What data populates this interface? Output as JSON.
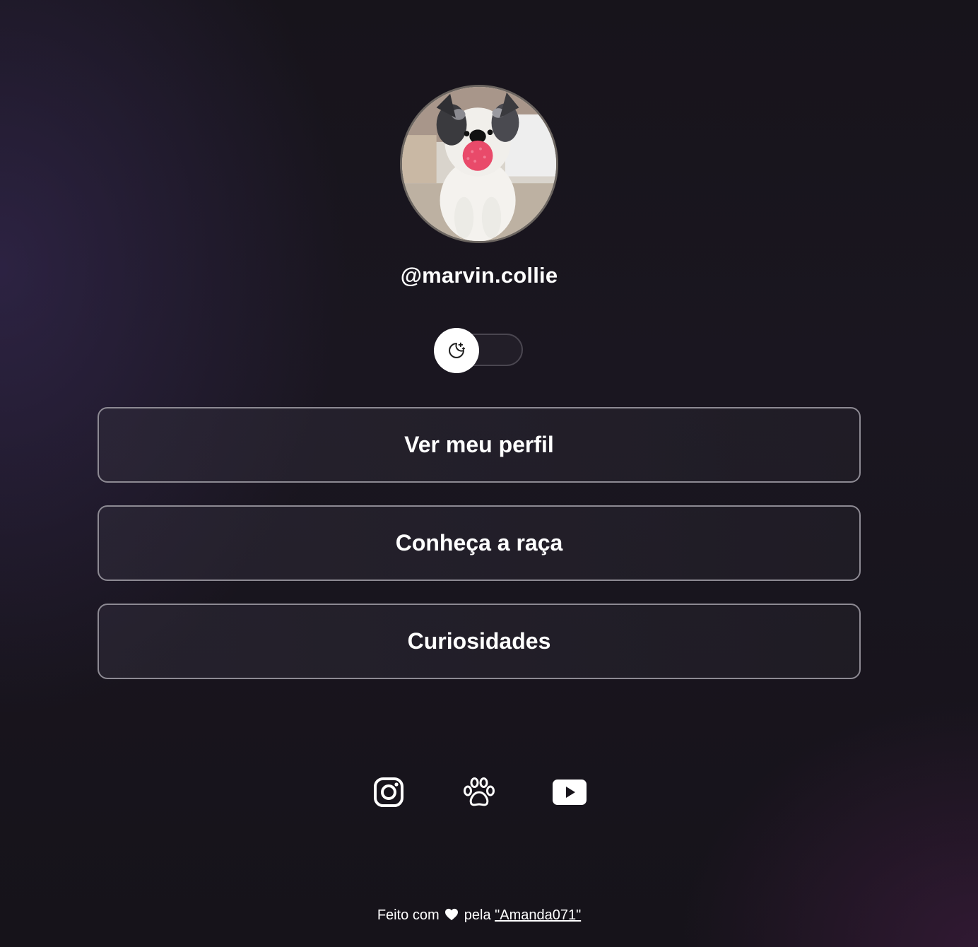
{
  "profile": {
    "avatar_alt": "dog-photo",
    "username": "@marvin.collie"
  },
  "theme_toggle": {
    "icon": "moon-stars-icon",
    "state": "dark"
  },
  "links": [
    {
      "label": "Ver meu perfil"
    },
    {
      "label": "Conheça a raça"
    },
    {
      "label": "Curiosidades"
    }
  ],
  "social": [
    {
      "icon": "instagram-icon"
    },
    {
      "icon": "paw-icon"
    },
    {
      "icon": "youtube-icon"
    }
  ],
  "footer": {
    "prefix": "Feito com",
    "heart_icon": "heart-icon",
    "middle": "pela",
    "author": "\"Amanda071\""
  },
  "colors": {
    "background": "#17141b",
    "text": "#ffffff",
    "button_border": "#8d8a93"
  }
}
